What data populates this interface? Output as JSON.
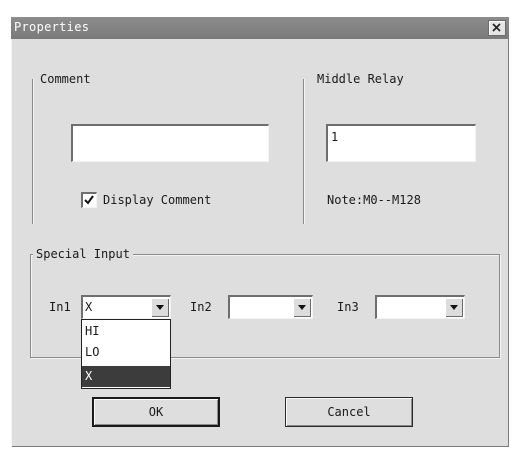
{
  "dialog": {
    "title": "Properties",
    "close_label": "×"
  },
  "comment_group": {
    "legend": "Comment",
    "input_value": "",
    "display_comment_label": "Display Comment",
    "display_comment_checked": true
  },
  "middle_relay_group": {
    "legend": "Middle Relay",
    "input_value": "1",
    "note": "Note:M0--M128"
  },
  "special_input_group": {
    "legend": "Special Input",
    "in1_label": "In1",
    "in1_value": "X",
    "in2_label": "In2",
    "in2_value": "",
    "in3_label": "In3",
    "in3_value": ""
  },
  "in1_dropdown": {
    "options": [
      "HI",
      "LO",
      "X"
    ],
    "selected": "X"
  },
  "buttons": {
    "ok": "OK",
    "cancel": "Cancel"
  },
  "icons": [
    "close-icon",
    "checkmark-icon",
    "chevron-down-icon"
  ]
}
